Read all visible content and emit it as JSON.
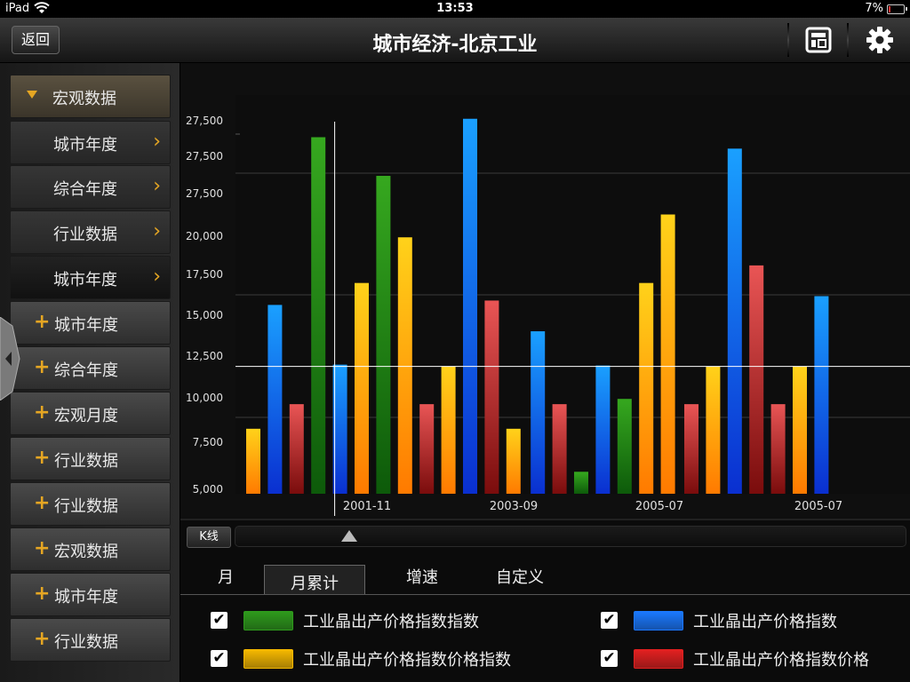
{
  "status": {
    "carrier": "iPad",
    "time": "13:53",
    "battery": "7%"
  },
  "nav": {
    "back_label": "返回",
    "title": "城市经济-北京工业"
  },
  "sidebar": {
    "items": [
      {
        "label": "宏观数据",
        "kind": "head"
      },
      {
        "label": "城市年度",
        "kind": "sub"
      },
      {
        "label": "综合年度",
        "kind": "sub"
      },
      {
        "label": "行业数据",
        "kind": "sub"
      },
      {
        "label": "城市年度",
        "kind": "sub-selected"
      },
      {
        "label": "城市年度",
        "kind": "plus"
      },
      {
        "label": "综合年度",
        "kind": "plus"
      },
      {
        "label": "宏观月度",
        "kind": "plus"
      },
      {
        "label": "行业数据",
        "kind": "plus"
      },
      {
        "label": "行业数据",
        "kind": "plus"
      },
      {
        "label": "宏观数据",
        "kind": "plus"
      },
      {
        "label": "城市年度",
        "kind": "plus"
      },
      {
        "label": "行业数据",
        "kind": "plus"
      }
    ]
  },
  "chart_data": {
    "type": "bar",
    "yticks": [
      "27,500",
      "27,500",
      "27,500",
      "20,000",
      "17,500",
      "15,000",
      "12,500",
      "10,000",
      "7,500",
      "5,000"
    ],
    "xticks": [
      "2001-11",
      "2003-09",
      "2005-07",
      "2005-07"
    ],
    "grid": true,
    "crosshair": {
      "x_bar_index": 4,
      "y_level": 12500
    },
    "colors": {
      "yellow": "#f5b800",
      "blue": "#1a78ff",
      "red": "#e22020",
      "green": "#2e9a1c"
    },
    "bars": [
      {
        "color": "yellow",
        "value": 8700
      },
      {
        "color": "blue",
        "value": 15750
      },
      {
        "color": "red",
        "value": 10100
      },
      {
        "color": "green",
        "value": 25300
      },
      {
        "color": "blue",
        "value": 12350
      },
      {
        "color": "yellow",
        "value": 17000
      },
      {
        "color": "green",
        "value": 23100
      },
      {
        "color": "yellow",
        "value": 19600
      },
      {
        "color": "red",
        "value": 10100
      },
      {
        "color": "yellow",
        "value": 12250
      },
      {
        "color": "blue",
        "value": 26350
      },
      {
        "color": "red",
        "value": 16000
      },
      {
        "color": "yellow",
        "value": 8700
      },
      {
        "color": "blue",
        "value": 14250
      },
      {
        "color": "red",
        "value": 10100
      },
      {
        "color": "green",
        "value": 6250
      },
      {
        "color": "blue",
        "value": 12300
      },
      {
        "color": "green",
        "value": 10400
      },
      {
        "color": "yellow",
        "value": 17000
      },
      {
        "color": "yellow",
        "value": 20900
      },
      {
        "color": "red",
        "value": 10100
      },
      {
        "color": "yellow",
        "value": 12250
      },
      {
        "color": "blue",
        "value": 24650
      },
      {
        "color": "red",
        "value": 18000
      },
      {
        "color": "red",
        "value": 10100
      },
      {
        "color": "yellow",
        "value": 12250
      },
      {
        "color": "blue",
        "value": 16250
      }
    ]
  },
  "slider": {
    "kline_label": "K线"
  },
  "tabs": [
    {
      "label": "月",
      "active": false
    },
    {
      "label": "月累计",
      "active": true
    },
    {
      "label": "增速",
      "active": false
    },
    {
      "label": "自定义",
      "active": false
    }
  ],
  "legend": [
    {
      "label": "工业晶出产价格指数指数",
      "color": "#2e9a1c",
      "checked": "✔"
    },
    {
      "label": "工业晶出产价格指数",
      "color": "#1a78ff",
      "checked": "✔"
    },
    {
      "label": "工业晶出产价格指数价格指数",
      "color": "#f5b800",
      "checked": "✔"
    },
    {
      "label": "工业晶出产价格指数价格",
      "color": "#e22020",
      "checked": "✔"
    }
  ]
}
